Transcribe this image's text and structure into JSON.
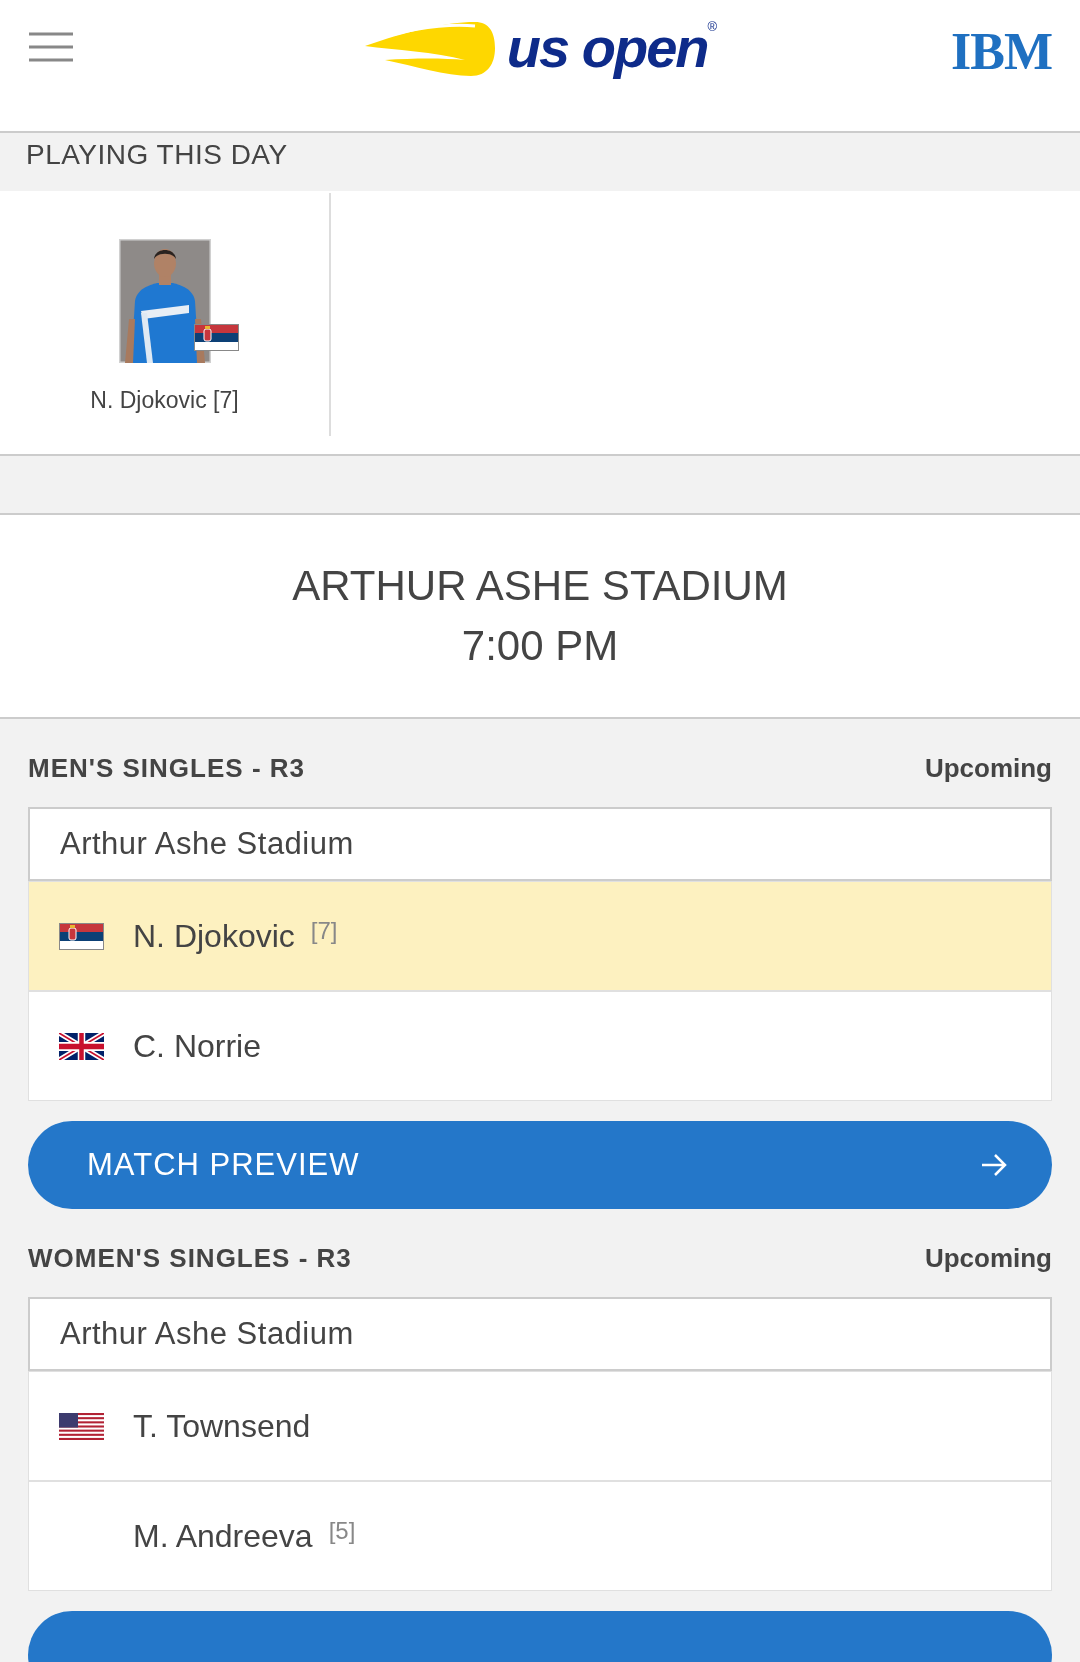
{
  "header": {
    "logo_text": "us open",
    "logo_mark": "®",
    "sponsor": "IBM"
  },
  "playing_today": {
    "title": "PLAYING THIS DAY",
    "players": [
      {
        "name": "N. Djokovic [7]",
        "flag": {
          "kind": "serbia"
        }
      }
    ]
  },
  "session": {
    "court": "ARTHUR ASHE STADIUM",
    "time": "7:00 PM"
  },
  "matches": [
    {
      "event": "MEN'S SINGLES - R3",
      "status": "Upcoming",
      "court": "Arthur Ashe Stadium",
      "players": [
        {
          "name": "N. Djokovic",
          "seed": "[7]",
          "flag": {
            "kind": "serbia"
          },
          "highlighted": true
        },
        {
          "name": "C. Norrie",
          "flag": {
            "kind": "uk"
          },
          "highlighted": false
        }
      ],
      "button": "MATCH PREVIEW"
    },
    {
      "event": "WOMEN'S SINGLES - R3",
      "status": "Upcoming",
      "court": "Arthur Ashe Stadium",
      "players": [
        {
          "name": "T. Townsend",
          "flag": {
            "kind": "usa"
          },
          "highlighted": false
        },
        {
          "name": "M. Andreeva",
          "seed": "[5]",
          "highlighted": false
        }
      ]
    }
  ]
}
